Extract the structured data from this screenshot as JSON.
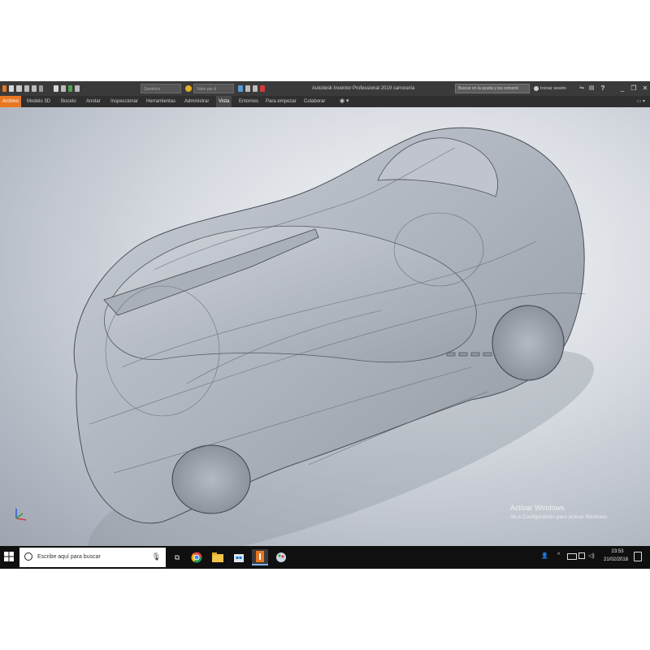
{
  "titlebar": {
    "quick_field_1": "Genérico",
    "quick_field_2": "Valor por d",
    "app_title": "Autodesk Inventor Professional 2019   carroceria",
    "help_search": "Buscar en la ayuda y los comand",
    "signin": "Iniciar sesión",
    "help_icon": "?"
  },
  "ribbon": {
    "tabs": [
      {
        "label": "Archivo"
      },
      {
        "label": "Modelo 3D"
      },
      {
        "label": "Boceto"
      },
      {
        "label": "Anotar"
      },
      {
        "label": "Inspeccionar"
      },
      {
        "label": "Herramientas"
      },
      {
        "label": "Administrar"
      },
      {
        "label": "Vista"
      },
      {
        "label": "Entornos"
      },
      {
        "label": "Para empezar"
      },
      {
        "label": "Colaborar"
      }
    ],
    "active_tab": "Vista"
  },
  "viewport": {
    "watermark_title": "Activar Windows",
    "watermark_sub": "Ve a Configuración para activar Windows."
  },
  "taskbar": {
    "search_placeholder": "Escribe aquí para buscar",
    "time": "23:53",
    "date": "21/02/2018"
  },
  "colors": {
    "titlebar": "#3a3a3a",
    "file_tab": "#e87722",
    "taskbar": "#101010",
    "viewport_light": "#f6f7f9",
    "viewport_dark": "#9ea5b0"
  }
}
